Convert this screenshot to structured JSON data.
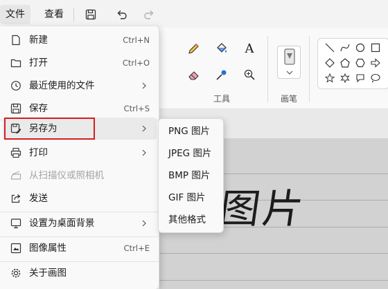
{
  "menubar": {
    "file_label": "文件",
    "view_label": "查看",
    "icons": [
      "save-icon",
      "undo-icon",
      "redo-icon"
    ]
  },
  "ribbon": {
    "tools_group_label": "工具",
    "brush_group_label": "画笔",
    "tools": [
      "pencil-icon",
      "fill-icon",
      "text-icon",
      "eraser-icon",
      "color-picker-icon",
      "magnifier-icon"
    ],
    "shapes": [
      "line",
      "curve",
      "oval",
      "rectangle",
      "diamond",
      "pentagon",
      "hexagon",
      "arrow",
      "star",
      "star6",
      "speech-bubble",
      "cloud-bubble"
    ]
  },
  "file_menu": {
    "items": [
      {
        "label": "新建",
        "shortcut": "Ctrl+N",
        "icon": "new-file-icon"
      },
      {
        "label": "打开",
        "shortcut": "Ctrl+O",
        "icon": "folder-icon"
      },
      {
        "label": "最近使用的文件",
        "icon": "clock-icon",
        "submenu": true
      },
      {
        "label": "保存",
        "shortcut": "Ctrl+S",
        "icon": "save-icon"
      },
      {
        "label": "另存为",
        "icon": "save-as-icon",
        "submenu": true,
        "highlighted": true
      },
      {
        "label": "打印",
        "icon": "printer-icon",
        "submenu": true
      },
      {
        "label": "从扫描仪或照相机",
        "icon": "scanner-icon",
        "disabled": true
      },
      {
        "label": "发送",
        "icon": "share-icon"
      },
      {
        "label": "设置为桌面背景",
        "icon": "desktop-icon",
        "submenu": true
      },
      {
        "label": "图像属性",
        "shortcut": "Ctrl+E",
        "icon": "properties-icon"
      },
      {
        "label": "关于画图",
        "icon": "gear-icon"
      }
    ]
  },
  "save_as_submenu": {
    "items": [
      "PNG 图片",
      "JPEG 图片",
      "BMP 图片",
      "GIF 图片",
      "其他格式"
    ]
  },
  "canvas": {
    "handwriting": "图片"
  },
  "colors": {
    "highlight_border": "#d41d1d",
    "menu_bg": "#f9f9f9",
    "paper": "#d2d2d2"
  }
}
